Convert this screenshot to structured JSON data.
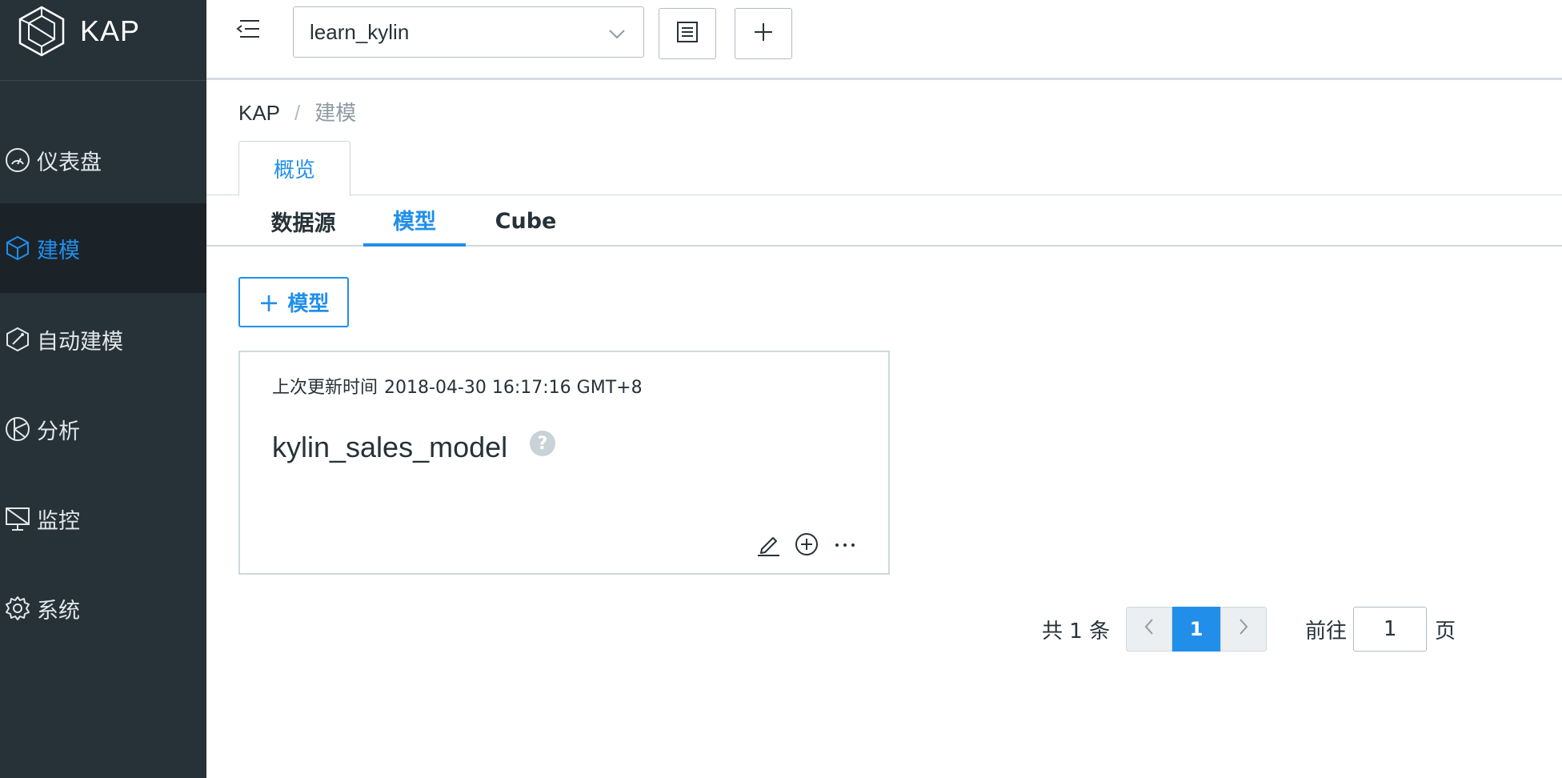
{
  "app": {
    "logo_text": "KAP"
  },
  "sidebar": {
    "items": [
      {
        "label": "仪表盘",
        "icon": "dashboard-icon"
      },
      {
        "label": "建模",
        "icon": "cube-icon",
        "active": true
      },
      {
        "label": "自动建模",
        "icon": "auto-model-icon"
      },
      {
        "label": "分析",
        "icon": "analysis-icon"
      },
      {
        "label": "监控",
        "icon": "monitor-icon"
      },
      {
        "label": "系统",
        "icon": "gear-icon"
      }
    ]
  },
  "topbar": {
    "project": "learn_kylin"
  },
  "breadcrumb": {
    "root": "KAP",
    "separator": "/",
    "current": "建模"
  },
  "tabs": {
    "overview": "概览"
  },
  "subtabs": [
    {
      "label": "数据源"
    },
    {
      "label": "模型",
      "active": true
    },
    {
      "label": "Cube"
    }
  ],
  "actions": {
    "add_model": "模型"
  },
  "model_card": {
    "updated_label": "上次更新时间",
    "updated_value": "2018-04-30 16:17:16 GMT+8",
    "name": "kylin_sales_model",
    "help": "?"
  },
  "pagination": {
    "total": "共 1 条",
    "current_page": "1",
    "goto_label": "前往",
    "goto_value": "1",
    "page_suffix": "页"
  },
  "colors": {
    "sidebar_bg": "#263238",
    "accent": "#218fea",
    "border": "#cfd8dc"
  }
}
